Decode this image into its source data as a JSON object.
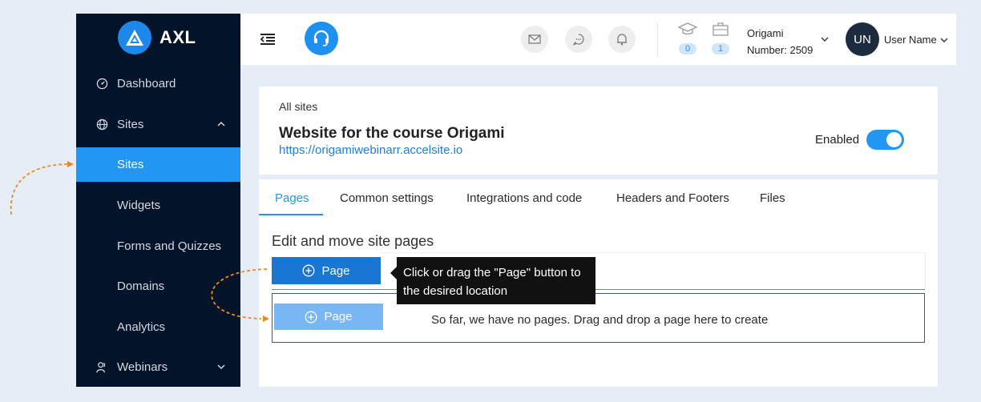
{
  "brand": {
    "name": "AXL"
  },
  "sidebar": {
    "items": [
      {
        "label": "Dashboard",
        "icon": "dashboard-icon"
      },
      {
        "label": "Sites",
        "icon": "globe-icon"
      },
      {
        "label": "Sites",
        "active": true
      },
      {
        "label": "Widgets"
      },
      {
        "label": "Forms and Quizzes"
      },
      {
        "label": "Domains"
      },
      {
        "label": "Analytics"
      },
      {
        "label": "Webinars",
        "icon": "webinars-icon"
      }
    ]
  },
  "topbar": {
    "courses_count": "0",
    "cases_count": "1",
    "org_name": "Origami",
    "org_number": "Number: 2509",
    "avatar_initials": "UN",
    "user_name": "User Name"
  },
  "site": {
    "breadcrumb": "All sites",
    "title": "Website for the course Origami",
    "url": "https://origamiwebinarr.accelsite.io",
    "status_label": "Enabled",
    "enabled": true
  },
  "tabs": [
    {
      "label": "Pages",
      "active": true
    },
    {
      "label": "Common settings"
    },
    {
      "label": "Integrations and code"
    },
    {
      "label": "Headers and Footers"
    },
    {
      "label": "Files"
    }
  ],
  "pages": {
    "section_title": "Edit and move site pages",
    "add_button_label": "Page",
    "ghost_button_label": "Page",
    "empty_message": "So far, we have no pages. Drag and drop a page here to create",
    "tooltip": "Click or drag the \"Page\" button to the desired location"
  },
  "colors": {
    "accent": "#2196f3",
    "sidebar_bg": "#03132a",
    "annotation": "#e8892a"
  }
}
